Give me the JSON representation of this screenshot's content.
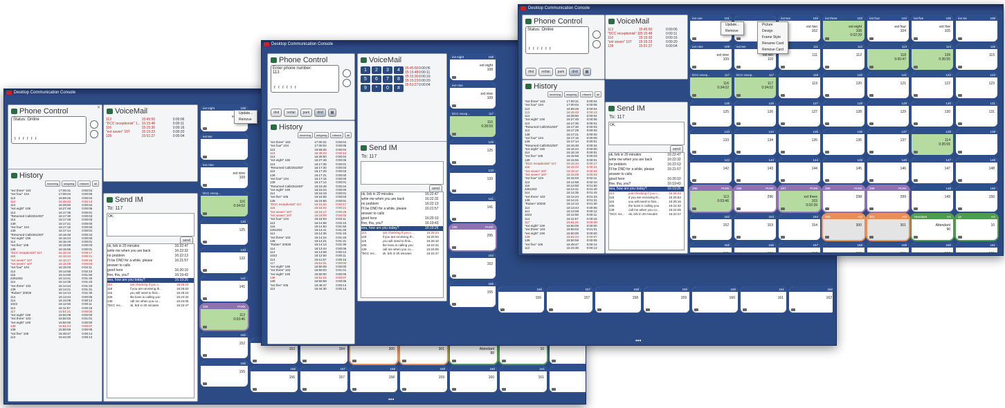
{
  "app": {
    "title": "Desktop Communication Console"
  },
  "phone": {
    "title": "Phone Control",
    "status": "Status: Online",
    "enter_label": "Enter phone number:",
    "enter_value": "113",
    "buttons": [
      "dnd",
      "redial",
      "park",
      "dnd"
    ],
    "buttons_w2": [
      "dnd",
      "redial",
      "park",
      "dnd"
    ]
  },
  "voicemail": {
    "title": "VoiceMail",
    "rows": [
      {
        "from": "113",
        "time": "15:45:50",
        "dur": "0:00:06"
      },
      {
        "from": "\"DCC receptionist\" 1...",
        "time": "15:15:48",
        "dur": "0:00:11"
      },
      {
        "from": "116",
        "time": "15:15:30",
        "dur": "0:00:16"
      },
      {
        "from": "\"ext seven\" 107",
        "time": "15:15:23",
        "dur": "0:00:20"
      },
      {
        "from": "139",
        "time": "15:51:27",
        "dur": "0:00:04"
      }
    ],
    "keypad": [
      "1",
      "2",
      "3",
      "4",
      "5",
      "6",
      "7",
      "8",
      "9",
      "*",
      "0",
      "#"
    ]
  },
  "history": {
    "title": "History",
    "filters": [
      "incoming",
      "outgoing",
      "missed",
      "all"
    ],
    "rows": [
      {
        "n": "\"ext three\" 103",
        "t": "17:00:31",
        "d": "0:00:04",
        "red": false
      },
      {
        "n": "\"ext four\" 104",
        "t": "17:00:04",
        "d": "0:00:05",
        "red": false
      },
      {
        "n": "113",
        "t": "16:59:25",
        "d": "0:00:04",
        "red": false
      },
      {
        "n": "113",
        "t": "16:45:43",
        "d": "0:00:13",
        "red": true
      },
      {
        "n": "113",
        "t": "16:28:50",
        "d": "0:00:04",
        "red": false
      },
      {
        "n": "\"ext eight\" 108",
        "t": "16:27:48",
        "d": "0:00:06",
        "red": false
      },
      {
        "n": "113",
        "t": "16:17:35",
        "d": "0:00:01",
        "red": false
      },
      {
        "n": "\"Returned Call2251003\"",
        "t": "16:17:30",
        "d": "0:00:03",
        "red": false
      },
      {
        "n": "113",
        "t": "16:17:29",
        "d": "0:00:03",
        "red": false
      },
      {
        "n": "139",
        "t": "16:17:21",
        "d": "0:00:00",
        "red": false
      },
      {
        "n": "\"ext four\" 104",
        "t": "16:17:15",
        "d": "0:00:00",
        "red": false
      },
      {
        "n": "139",
        "t": "16:17:14",
        "d": "0:00:01",
        "red": false
      },
      {
        "n": "\"Returned Call2251003\"",
        "t": "16:16:48",
        "d": "0:00:34",
        "red": false
      },
      {
        "n": "\"ext eight\" 108",
        "t": "16:16:24",
        "d": "0:00:00",
        "red": false
      },
      {
        "n": "114",
        "t": "16:16:19",
        "d": "0:00:01",
        "red": false
      },
      {
        "n": "\"ext five\" 105",
        "t": "16:15:59",
        "d": "0:00:03",
        "red": false
      },
      {
        "n": "139",
        "t": "16:15:55",
        "d": "0:00:01",
        "red": false
      },
      {
        "n": "\"DCC receptionist\" 117",
        "t": "16:15:34",
        "d": "0:00:17",
        "red": true
      },
      {
        "n": "116",
        "t": "16:15:24",
        "d": "0:00:21",
        "red": true
      },
      {
        "n": "\"ext seven\" 107",
        "t": "16:15:17",
        "d": "0:00:26",
        "red": true
      },
      {
        "n": "\"ext seven\" 107",
        "t": "16:15:09",
        "d": "0:00:03",
        "red": true
      },
      {
        "n": "\"ext four\" 104",
        "t": "16:15:03",
        "d": "0:02:11",
        "red": false
      },
      {
        "n": "113",
        "t": "16:14:58",
        "d": "0:02:10",
        "red": false
      },
      {
        "n": "116",
        "t": "16:14:50",
        "d": "0:01:50",
        "red": false
      },
      {
        "n": "2251003",
        "t": "16:14:41",
        "d": "0:01:40",
        "red": false
      },
      {
        "n": "114",
        "t": "16:14:35",
        "d": "0:01:43",
        "red": false
      },
      {
        "n": "\"ext three\" 103",
        "t": "16:14:24",
        "d": "0:01:33",
        "red": false
      },
      {
        "n": "139",
        "t": "16:14:21",
        "d": "0:01:31",
        "red": false
      },
      {
        "n": "\"Ruben\" 20030",
        "t": "16:14:13",
        "d": "0:01:30",
        "red": false
      },
      {
        "n": "114",
        "t": "16:13:44",
        "d": "0:00:06",
        "red": false
      },
      {
        "n": "114",
        "t": "16:13:08",
        "d": "0:00:12",
        "red": false
      },
      {
        "n": "1023",
        "t": "16:12:50",
        "d": "0:00:11",
        "red": false
      },
      {
        "n": "114",
        "t": "16:11:57",
        "d": "0:00:15",
        "red": false
      },
      {
        "n": "117",
        "t": "15:51:21",
        "d": "0:00:00",
        "red": true
      },
      {
        "n": "\"ext eight\" 108",
        "t": "15:50:09",
        "d": "0:00:00",
        "red": false
      },
      {
        "n": "\"ext three\" 103",
        "t": "15:50:03",
        "d": "0:01:01",
        "red": false
      },
      {
        "n": "\"ext eight\" 108",
        "t": "15:50:00",
        "d": "0:00:00",
        "red": false
      },
      {
        "n": "139",
        "t": "15:51:24",
        "d": "0:00:07",
        "red": true
      },
      {
        "n": "139",
        "t": "15:50:59",
        "d": "0:00:05",
        "red": false
      },
      {
        "n": "\"ext five\" 105",
        "t": "15:48:47",
        "d": "0:00:14",
        "red": false
      },
      {
        "n": "113",
        "t": "15:44:30",
        "d": "0:00:13",
        "red": false
      }
    ]
  },
  "im": {
    "title": "Send IM",
    "to": "To: 117",
    "input": "OK,",
    "send_label": "send",
    "messages": [
      {
        "m": "ok, brb in 20 minutes",
        "t": "16:22:47"
      },
      {
        "m": "write me when you are back",
        "t": "16:22:32"
      },
      {
        "m": "no problem",
        "t": "16:22:13"
      },
      {
        "m": "I'll be DND for a while, please",
        "t": "16:21:57"
      },
      {
        "m": "answer to calls",
        "t": ""
      },
      {
        "m": "good here",
        "t": "16:20:10"
      },
      {
        "m": "fine, tha, you?",
        "t": "16:19:43"
      },
      {
        "m": "sea, how are you today?",
        "t": "16:19:26"
      }
    ],
    "log": [
      {
        "n": "114",
        "m": "just checking if you c...",
        "t": "16:26:24",
        "red": true
      },
      {
        "n": "118",
        "m": "if you are receiving th...",
        "t": "16:25:53",
        "red": false
      },
      {
        "n": "116",
        "m": "you will need to finis...",
        "t": "16:25:16",
        "red": false
      },
      {
        "n": "106",
        "m": "the boss is calling you",
        "t": "16:24:32",
        "red": false
      },
      {
        "n": "139",
        "m": "call me when you co...",
        "t": "16:24:05",
        "red": false
      },
      {
        "n": "\"DCC rec...",
        "m": "ok, brb in 20 minutes",
        "t": "16:22:47",
        "red": false
      }
    ]
  },
  "context_menu": {
    "items": [
      "Update...",
      "Remove"
    ]
  },
  "context_sub": {
    "items": [
      "Picture",
      "Design",
      "Frame Style",
      "Rename Card",
      "Remove Card"
    ]
  },
  "cards_w3": [
    {
      "ext": "ext one",
      "num": "101",
      "name": "",
      "kind": "plain"
    },
    {
      "ext": "",
      "num": "",
      "name": "",
      "kind": "plain"
    },
    {
      "ext": "ext two",
      "num": "102",
      "name": "ext two\n102",
      "kind": "plain"
    },
    {
      "ext": "ext three",
      "num": "103",
      "name": "ext eight\n108\n0:02:39",
      "kind": "green"
    },
    {
      "ext": "ext four",
      "num": "104",
      "name": "ext four\n104",
      "kind": "plain"
    },
    {
      "ext": "ext five",
      "num": "105",
      "name": "ext five\n105",
      "kind": "plain"
    },
    {
      "ext": "ext six",
      "num": "106",
      "name": "",
      "kind": "plain"
    },
    {
      "ext": "ext nine",
      "num": "109",
      "name": "ext nine\n109",
      "kind": "plain"
    },
    {
      "ext": "ext ten",
      "num": "110",
      "name": "ext ten\n110",
      "kind": "plain"
    },
    {
      "ext": "",
      "num": "111",
      "name": "111",
      "kind": "plain"
    },
    {
      "ext": "",
      "num": "112",
      "name": "112",
      "kind": "plain"
    },
    {
      "ext": "",
      "num": "113",
      "name": "118\n0:00:47",
      "kind": "green"
    },
    {
      "ext": "",
      "num": "114",
      "name": "139\n0:35:55",
      "kind": "green"
    },
    {
      "ext": "",
      "num": "115",
      "name": "115",
      "kind": "plain"
    },
    {
      "ext": "DCC recep...",
      "num": "117",
      "name": "116\n0:34:02",
      "kind": "green"
    },
    {
      "ext": "DCC recep...",
      "num": "117",
      "name": "117\n0:34:02",
      "kind": "green"
    },
    {
      "ext": "",
      "num": "119",
      "name": "119",
      "kind": "plain"
    },
    {
      "ext": "",
      "num": "120",
      "name": "120",
      "kind": "plain"
    },
    {
      "ext": "",
      "num": "121",
      "name": "121",
      "kind": "plain"
    },
    {
      "ext": "",
      "num": "122",
      "name": "122",
      "kind": "plain"
    },
    {
      "ext": "",
      "num": "123",
      "name": "123",
      "kind": "plain"
    },
    {
      "ext": "",
      "num": "125",
      "name": "125",
      "kind": "plain"
    },
    {
      "ext": "",
      "num": "126",
      "name": "126",
      "kind": "plain"
    },
    {
      "ext": "",
      "num": "127",
      "name": "127",
      "kind": "plain"
    },
    {
      "ext": "",
      "num": "128",
      "name": "128",
      "kind": "plain"
    },
    {
      "ext": "",
      "num": "129",
      "name": "129",
      "kind": "plain"
    },
    {
      "ext": "",
      "num": "130",
      "name": "130",
      "kind": "plain"
    },
    {
      "ext": "",
      "num": "131",
      "name": "131",
      "kind": "plain"
    },
    {
      "ext": "",
      "num": "133",
      "name": "133",
      "kind": "plain"
    },
    {
      "ext": "",
      "num": "134",
      "name": "134",
      "kind": "plain"
    },
    {
      "ext": "",
      "num": "135",
      "name": "135",
      "kind": "plain"
    },
    {
      "ext": "",
      "num": "136",
      "name": "136",
      "kind": "plain"
    },
    {
      "ext": "",
      "num": "137",
      "name": "137",
      "kind": "plain"
    },
    {
      "ext": "",
      "num": "138",
      "name": "114\n0:35:55",
      "kind": "green"
    },
    {
      "ext": "",
      "num": "139",
      "name": "",
      "kind": "plain"
    },
    {
      "ext": "",
      "num": "142",
      "name": "142",
      "kind": "plain"
    },
    {
      "ext": "",
      "num": "143",
      "name": "143",
      "kind": "plain"
    },
    {
      "ext": "",
      "num": "144",
      "name": "144",
      "kind": "plain"
    },
    {
      "ext": "",
      "num": "145",
      "name": "145",
      "kind": "plain"
    },
    {
      "ext": "",
      "num": "146",
      "name": "146",
      "kind": "plain"
    },
    {
      "ext": "",
      "num": "147",
      "name": "147",
      "kind": "plain"
    },
    {
      "ext": "",
      "num": "148",
      "name": "148",
      "kind": "plain"
    },
    {
      "ext": "295",
      "num": "PARK",
      "name": "113\n0:03:46",
      "kind": "park green"
    },
    {
      "ext": "296",
      "num": "PARK",
      "name": "296",
      "kind": "park"
    },
    {
      "ext": "297",
      "num": "PARK",
      "name": "ext three\n103\n0:02:39",
      "kind": "park green"
    },
    {
      "ext": "298",
      "num": "PARK",
      "name": "298",
      "kind": "park"
    },
    {
      "ext": "299",
      "num": "PARK",
      "name": "299",
      "kind": "park"
    },
    {
      "ext": "",
      "num": "149",
      "name": "149",
      "kind": "plain"
    },
    {
      "ext": "",
      "num": "150",
      "name": "150",
      "kind": "plain"
    },
    {
      "ext": "",
      "num": "152",
      "name": "152",
      "kind": "plain"
    },
    {
      "ext": "",
      "num": "153",
      "name": "153",
      "kind": "plain"
    },
    {
      "ext": "",
      "num": "154",
      "name": "154",
      "kind": "plain"
    },
    {
      "ext": "300",
      "num": "AO",
      "name": "300",
      "kind": "ao"
    },
    {
      "ext": "301",
      "num": "AO",
      "name": "301",
      "kind": "ao"
    },
    {
      "ext": "Attendant",
      "num": "AA",
      "name": "Attendant\n90",
      "kind": "att"
    },
    {
      "ext": "10",
      "num": "AA",
      "name": "10",
      "kind": "att"
    },
    {
      "ext": "",
      "num": "155",
      "name": "155",
      "kind": "plain"
    },
    {
      "ext": "",
      "num": "156",
      "name": "156",
      "kind": "plain"
    },
    {
      "ext": "",
      "num": "157",
      "name": "157",
      "kind": "plain"
    },
    {
      "ext": "",
      "num": "158",
      "name": "158",
      "kind": "plain"
    },
    {
      "ext": "",
      "num": "159",
      "name": "159",
      "kind": "plain"
    },
    {
      "ext": "",
      "num": "160",
      "name": "160",
      "kind": "plain"
    },
    {
      "ext": "",
      "num": "161",
      "name": "161",
      "kind": "plain"
    },
    {
      "ext": "",
      "num": "162",
      "name": "162",
      "kind": "plain"
    }
  ],
  "cards_w1": [
    {
      "ext": "ext eight",
      "num": "108",
      "name": "ext eight\n108",
      "kind": "plain"
    },
    {
      "ext": "ext ten",
      "num": "",
      "name": "",
      "kind": "plain"
    },
    {
      "ext": "ext nine",
      "num": "",
      "name": "ext nine\n109",
      "kind": "plain"
    },
    {
      "ext": "DCC recep...",
      "num": "",
      "name": "116\n0:34:02",
      "kind": "green"
    },
    {
      "ext": "",
      "num": "125",
      "name": "125",
      "kind": "plain"
    },
    {
      "ext": "",
      "num": "133",
      "name": "133",
      "kind": "plain"
    },
    {
      "ext": "",
      "num": "141",
      "name": "141",
      "kind": "plain"
    },
    {
      "ext": "295",
      "num": "PARK",
      "name": "113\n0:03:46",
      "kind": "park green"
    },
    {
      "ext": "",
      "num": "152",
      "name": "152",
      "kind": "plain"
    },
    {
      "ext": "",
      "num": "155",
      "name": "155",
      "kind": "plain"
    }
  ],
  "bottom_w1": [
    {
      "ext": "",
      "num": "153",
      "name": "153",
      "kind": "plain"
    },
    {
      "ext": "",
      "num": "154",
      "name": "154",
      "kind": "plain"
    },
    {
      "ext": "",
      "num": "300",
      "name": "300",
      "kind": "orangeplain"
    },
    {
      "ext": "",
      "num": "301",
      "name": "301",
      "kind": "orangeplain"
    },
    {
      "ext": "",
      "num": "AA",
      "name": "Attendant\n88",
      "kind": "greenplain"
    },
    {
      "ext": "",
      "num": "10",
      "name": "10",
      "kind": "greenplain"
    },
    {
      "ext": "",
      "num": "283",
      "name": "283",
      "kind": "plain"
    },
    {
      "ext": "",
      "num": "156",
      "name": "156",
      "kind": "plain"
    },
    {
      "ext": "",
      "num": "157",
      "name": "157",
      "kind": "plain"
    },
    {
      "ext": "",
      "num": "158",
      "name": "158",
      "kind": "plain"
    },
    {
      "ext": "",
      "num": "159",
      "name": "159",
      "kind": "plain"
    },
    {
      "ext": "",
      "num": "160",
      "name": "160",
      "kind": "plain"
    },
    {
      "ext": "",
      "num": "161",
      "name": "161",
      "kind": "plain"
    },
    {
      "ext": "",
      "num": "162",
      "name": "162",
      "kind": "plain"
    }
  ],
  "cards_w2": [
    {
      "ext": "ext eight",
      "num": "108",
      "name": "ext eight\n108",
      "kind": "plain"
    },
    {
      "ext": "ext nine",
      "num": "",
      "name": "ext nine\n109",
      "kind": "plain"
    },
    {
      "ext": "DCC recep...",
      "num": "117",
      "name": "116\n0:28:59",
      "kind": "green"
    },
    {
      "ext": "",
      "num": "125",
      "name": "125",
      "kind": "plain"
    },
    {
      "ext": "",
      "num": "133",
      "name": "133",
      "kind": "plain"
    },
    {
      "ext": "",
      "num": "141",
      "name": "141",
      "kind": "plain"
    },
    {
      "ext": "295",
      "num": "PARK",
      "name": "295",
      "kind": "park"
    },
    {
      "ext": "",
      "num": "152",
      "name": "152",
      "kind": "plain"
    },
    {
      "ext": "",
      "num": "155",
      "name": "155",
      "kind": "plain"
    }
  ],
  "bottom_w2": [
    {
      "ext": "",
      "num": "156",
      "name": "156",
      "kind": "plain"
    },
    {
      "ext": "",
      "num": "157",
      "name": "157",
      "kind": "plain"
    },
    {
      "ext": "",
      "num": "158",
      "name": "158",
      "kind": "plain"
    },
    {
      "ext": "",
      "num": "159",
      "name": "159",
      "kind": "plain"
    },
    {
      "ext": "",
      "num": "160",
      "name": "160",
      "kind": "plain"
    },
    {
      "ext": "",
      "num": "161",
      "name": "161",
      "kind": "plain"
    },
    {
      "ext": "",
      "num": "162",
      "name": "162",
      "kind": "plain"
    }
  ]
}
